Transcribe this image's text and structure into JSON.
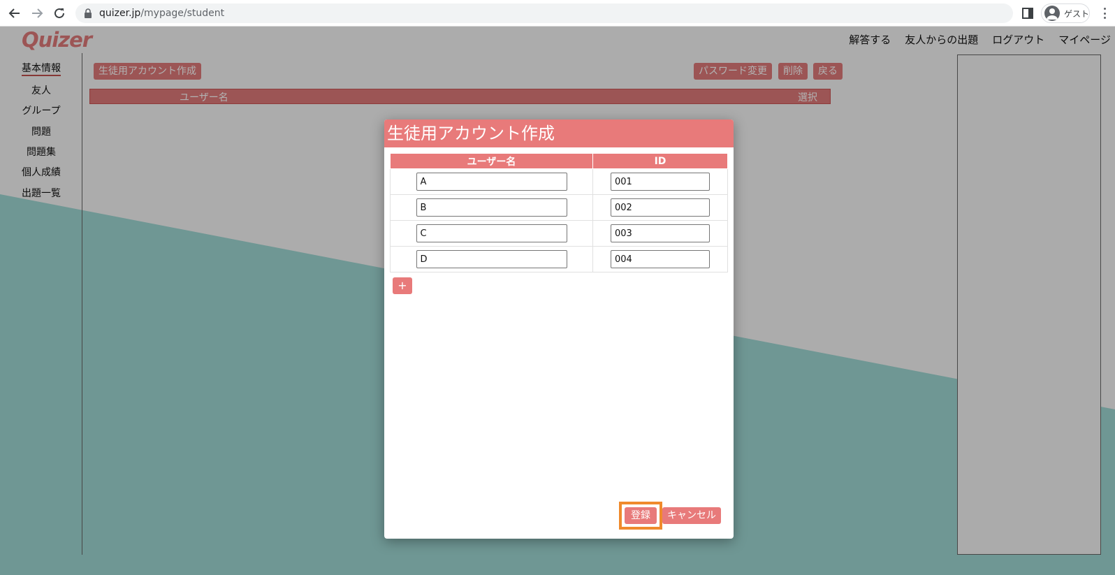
{
  "browser": {
    "url_host": "quizer.jp",
    "url_path": "/mypage/student",
    "profile_label": "ゲスト"
  },
  "site": {
    "logo": "Quizer",
    "topnav": [
      "解答する",
      "友人からの出題",
      "ログアウト",
      "マイページ"
    ]
  },
  "sidebar": {
    "items": [
      "基本情報",
      "友人",
      "グループ",
      "問題",
      "問題集",
      "個人成績",
      "出題一覧"
    ]
  },
  "main": {
    "create_button": "生徒用アカウント作成",
    "password_button": "パスワード変更",
    "delete_button": "削除",
    "back_button": "戻る",
    "table_headers": [
      "ユーザー名",
      "選択"
    ]
  },
  "modal": {
    "title": "生徒用アカウント作成",
    "col_username": "ユーザー名",
    "col_id": "ID",
    "rows": [
      {
        "username": "A",
        "id": "001"
      },
      {
        "username": "B",
        "id": "002"
      },
      {
        "username": "C",
        "id": "003"
      },
      {
        "username": "D",
        "id": "004"
      }
    ],
    "add_label": "+",
    "register_label": "登録",
    "cancel_label": "キャンセル"
  },
  "colors": {
    "accent": "#e87a7a",
    "highlight": "#f08a2c",
    "teal": "#9fd8d4"
  }
}
